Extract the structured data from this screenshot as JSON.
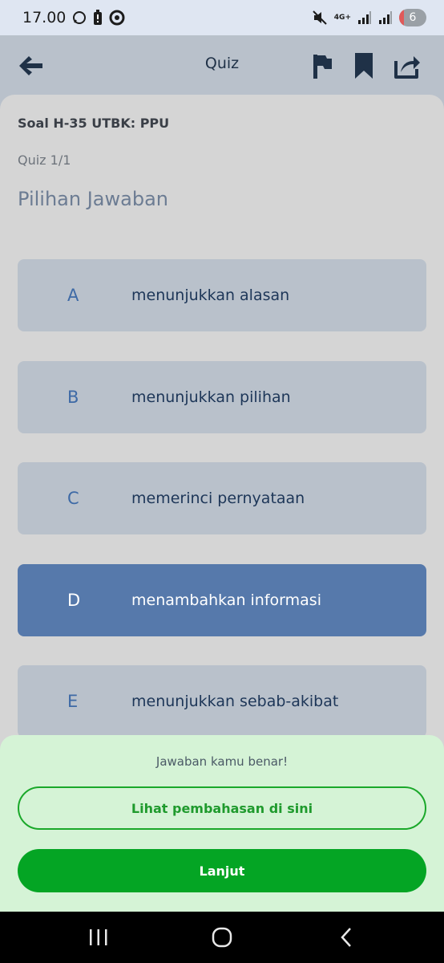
{
  "status_bar": {
    "time": "17.00",
    "network": "4G+",
    "battery_level": "6"
  },
  "header": {
    "title": "Quiz",
    "icons": {
      "back": "arrow-left-icon",
      "flag": "flag-icon",
      "bookmark": "bookmark-icon",
      "share": "share-icon"
    }
  },
  "quiz": {
    "source": "Soal H-35 UTBK: PPU",
    "progress": "Quiz 1/1",
    "section_title": "Pilihan Jawaban",
    "options": [
      {
        "letter": "A",
        "text": "menunjukkan alasan",
        "selected": false
      },
      {
        "letter": "B",
        "text": "menunjukkan pilihan",
        "selected": false
      },
      {
        "letter": "C",
        "text": "memerinci pernyataan",
        "selected": false
      },
      {
        "letter": "D",
        "text": "menambahkan informasi",
        "selected": true
      },
      {
        "letter": "E",
        "text": "menunjukkan sebab-akibat",
        "selected": false
      }
    ]
  },
  "feedback": {
    "message": "Jawaban kamu benar!",
    "explain_label": "Lihat pembahasan di sini",
    "next_label": "Lanjut"
  },
  "colors": {
    "selected_option": "#5679ab",
    "option": "#b9c1cb",
    "success_green": "#04a524",
    "feedback_bg": "#d5f3d6"
  }
}
